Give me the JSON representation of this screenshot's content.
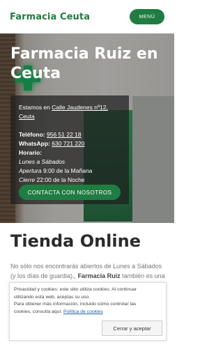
{
  "header": {
    "site_title": "Farmacia Ceuta",
    "menu_label": "MENÚ"
  },
  "hero": {
    "title": "Farmacia Ruiz en Ceuta",
    "address_prefix": "Estamos en",
    "address_link": "Calle Jaudenes nº12, Ceuta",
    "phone_label": "Teléfono:",
    "phone_link": "956 51 22 18",
    "whatsapp_label": "WhatsApp:",
    "whatsapp_link": "630 721 220",
    "hours_label": "Horario:",
    "hours_days": "Lunes a Sábados",
    "hours_open_label": "Apertura",
    "hours_open": "9:00 de la Mañana",
    "hours_close_label": "Cierre",
    "hours_close": "22:00 de la Noche",
    "contact_button": "CONTACTA CON NOSOTROS"
  },
  "main": {
    "section_title": "Tienda Online",
    "intro_line1": "No sólo nos encontrarás abiertos de Lunes a Sábados",
    "intro_line2_a": "(y los días de guardia),",
    "intro_brand": "Farmacia Ruiz",
    "intro_line2_b": "también es una"
  },
  "cookie": {
    "line1": "Privacidad y cookies: este sitio utiliza cookies. Al continuar utilizando esta web, aceptas su uso.",
    "line2": "Para obtener más información, incluido cómo controlar las cookies, consulta aquí:",
    "policy_link": "Política de cookies",
    "accept_button": "Cerrar y aceptar"
  },
  "colors": {
    "brand_green": "#1f7d41"
  }
}
